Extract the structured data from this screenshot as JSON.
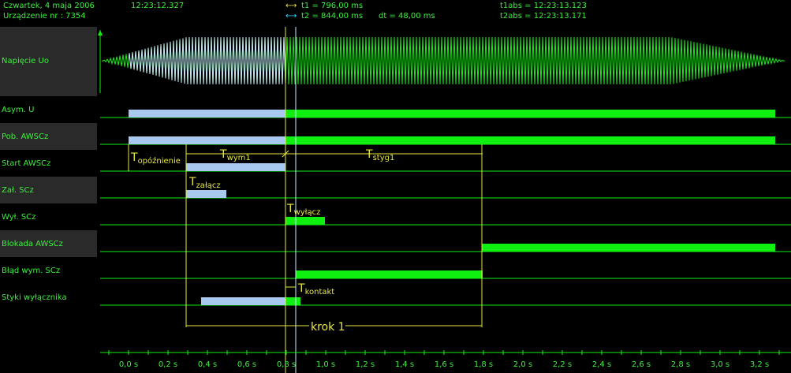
{
  "header": {
    "date": "Czwartek,  4  maja  2006",
    "device": "Urządzenie nr :  7354",
    "time": "12:23:12.327",
    "t1": "t1 = 796,00 ms",
    "t2": "t2 = 844,00 ms",
    "dt": "dt = 48,00 ms",
    "t1abs": "t1abs = 12:23:13.123",
    "t2abs": "t2abs = 12:23:13.171"
  },
  "rows": [
    {
      "label": "Napięcie Uo",
      "shaded": true
    },
    {
      "label": "Asym. U",
      "shaded": false
    },
    {
      "label": "Pob. AWSCz",
      "shaded": true
    },
    {
      "label": "Start AWSCz",
      "shaded": false
    },
    {
      "label": "Zał. SCz",
      "shaded": true
    },
    {
      "label": "Wył. SCz",
      "shaded": false
    },
    {
      "label": "Blokada AWSCz",
      "shaded": true
    },
    {
      "label": "Błąd wym. SCz",
      "shaded": false
    },
    {
      "label": "Styki  wyłącznika",
      "shaded": false
    }
  ],
  "axis": {
    "ticks": [
      "0,0 s",
      "0,2 s",
      "0,4 s",
      "0,6 s",
      "0,8 s",
      "1,0 s",
      "1,2 s",
      "1,4 s",
      "1,6 s",
      "1,8 s",
      "2,0 s",
      "2,2 s",
      "2,4 s",
      "2,6 s",
      "2,8 s",
      "3,0 s",
      "3,2 s"
    ]
  },
  "annotations": {
    "t_opoznienie": {
      "main": "T",
      "sub": "opóźnienie"
    },
    "t_wym1": {
      "main": "T",
      "sub": "wym1"
    },
    "t_styg1": {
      "main": "T",
      "sub": "styg1"
    },
    "t_zalacz": {
      "main": "T",
      "sub": "załącz"
    },
    "t_wylacz": {
      "main": "T",
      "sub": "wyłącz"
    },
    "t_kontakt": {
      "main": "T",
      "sub": "kontakt"
    },
    "krok": "krok 1"
  },
  "colors": {
    "background": "#000000",
    "signal_green": "#10f010",
    "signal_blue": "#a8c8f0",
    "text_green": "#3cf03c",
    "annotation_yellow": "#e8e840",
    "cursor2_cyan": "#30d8ff",
    "row_shade": "#2a2a2a"
  }
}
